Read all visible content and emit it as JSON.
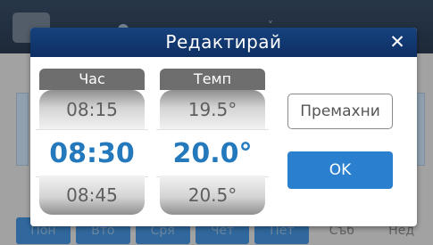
{
  "dialog": {
    "title": "Редактирай",
    "close_glyph": "✕",
    "hour": {
      "label": "Час",
      "prev": "08:15",
      "current": "08:30",
      "next": "08:45"
    },
    "temp": {
      "label": "Темп",
      "prev": "19.5°",
      "current": "20.0°",
      "next": "20.5°"
    },
    "remove_label": "Премахни",
    "ok_label": "OK"
  },
  "background": {
    "days": [
      {
        "label": "Пон",
        "active": true
      },
      {
        "label": "Вто",
        "active": true
      },
      {
        "label": "Сря",
        "active": true
      },
      {
        "label": "Чет",
        "active": true
      },
      {
        "label": "Пет",
        "active": true
      },
      {
        "label": "Съб",
        "active": false
      },
      {
        "label": "Нед",
        "active": false
      }
    ]
  },
  "colors": {
    "header": "#17427e",
    "accent": "#2479bd",
    "ok_button": "#2a7fcf"
  }
}
